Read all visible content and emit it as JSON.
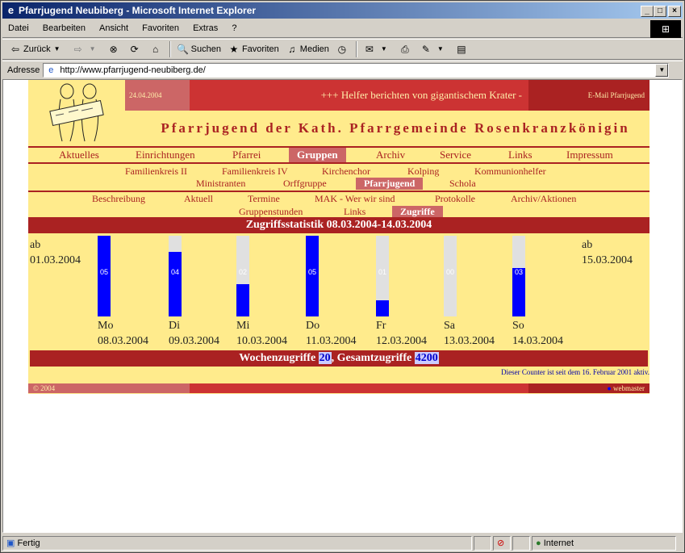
{
  "window": {
    "title": "Pfarrjugend Neubiberg - Microsoft Internet Explorer",
    "min": "_",
    "max": "□",
    "close": "×"
  },
  "menu": [
    "Datei",
    "Bearbeiten",
    "Ansicht",
    "Favoriten",
    "Extras",
    "?"
  ],
  "toolbar": {
    "back": "Zurück",
    "search": "Suchen",
    "favorites": "Favoriten",
    "media": "Medien"
  },
  "address": {
    "label": "Adresse",
    "url": "http://www.pfarrjugend-neubiberg.de/"
  },
  "page": {
    "date": "24.04.2004",
    "ticker": "+++ Helfer berichten von gigantischem Krater -",
    "email": "E-Mail Pfarrjugend",
    "site_title": "Pfarrjugend der Kath. Pfarrgemeinde Rosenkranzkönigin",
    "nav1": [
      "Aktuelles",
      "Einrichtungen",
      "Pfarrei",
      "Gruppen",
      "Archiv",
      "Service",
      "Links",
      "Impressum"
    ],
    "nav1_active": "Gruppen",
    "nav2_row1": [
      "Familienkreis II",
      "Familienkreis IV",
      "Kirchenchor",
      "Kolping",
      "Kommunionhelfer"
    ],
    "nav2_row2": [
      "Ministranten",
      "Orffgruppe",
      "Pfarrjugend",
      "Schola"
    ],
    "nav2_active": "Pfarrjugend",
    "nav3_row1": [
      "Beschreibung",
      "Aktuell",
      "Termine",
      "MAK - Wer wir sind",
      "Protokolle",
      "Archiv/Aktionen"
    ],
    "nav3_row2": [
      "Gruppenstunden",
      "Links",
      "Zugriffe"
    ],
    "nav3_active": "Zugriffe",
    "stats_title": "Zugriffsstatistik 08.03.2004-14.03.2004",
    "left_label": [
      "ab",
      "01.03.2004"
    ],
    "right_label": [
      "ab",
      "15.03.2004"
    ],
    "days": [
      {
        "day": "Mo",
        "date": "08.03.2004",
        "value": 5,
        "label": "05"
      },
      {
        "day": "Di",
        "date": "09.03.2004",
        "value": 4,
        "label": "04"
      },
      {
        "day": "Mi",
        "date": "10.03.2004",
        "value": 2,
        "label": "02"
      },
      {
        "day": "Do",
        "date": "11.03.2004",
        "value": 5,
        "label": "05"
      },
      {
        "day": "Fr",
        "date": "12.03.2004",
        "value": 1,
        "label": "01"
      },
      {
        "day": "Sa",
        "date": "13.03.2004",
        "value": 0,
        "label": "00"
      },
      {
        "day": "So",
        "date": "14.03.2004",
        "value": 3,
        "label": "03"
      }
    ],
    "max_value": 5,
    "week_label": "Wochenzugriffe",
    "week_value": "20",
    "total_label": "Gesamtzugriffe",
    "total_value": "4200",
    "comma": ",",
    "counter_note": "Dieser Counter ist seit dem 16. Februar 2001 aktiv.",
    "copyright": "© 2004",
    "webmaster": "webmaster"
  },
  "status": {
    "text": "Fertig",
    "zone": "Internet"
  }
}
